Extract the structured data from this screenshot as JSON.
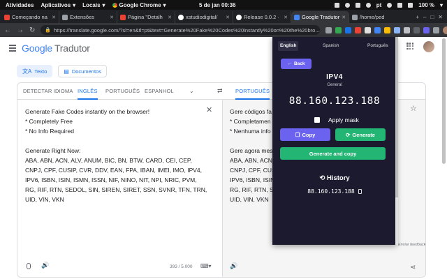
{
  "os_bar": {
    "activities": "Atividades",
    "applications": "Aplicativos",
    "places": "Locais",
    "active_app": "Google Chrome",
    "datetime": "5 de jan  00:36",
    "language": "pt",
    "battery": "100 %"
  },
  "tabs": [
    {
      "label": "Começando na",
      "color": "#ea4335"
    },
    {
      "label": "Extensões",
      "color": "#5f6368"
    },
    {
      "label": "Página \"Detalh",
      "color": "#ea4335"
    },
    {
      "label": "xstudiodigital/",
      "color": "#ffffff"
    },
    {
      "label": "Release 0.0.2 ·",
      "color": "#ffffff"
    },
    {
      "label": "Google Tradutor",
      "color": "#4285f4"
    },
    {
      "label": "/home/ped",
      "color": "#5f6368"
    }
  ],
  "address_bar": {
    "url": "https://translate.google.com/?sl=en&tl=pt&text=Generate%20Fake%20Codes%20instantly%20on%20the%20bro..."
  },
  "translate": {
    "logo_google": "Google",
    "logo_product": "Tradutor",
    "mode_text": "Texto",
    "mode_documents": "Documentos",
    "src_langs": [
      "DETECTAR IDIOMA",
      "INGLÊS",
      "PORTUGUÊS",
      "ESPANHOL"
    ],
    "tgt_langs": [
      "PORTUGUÊS"
    ],
    "source_text": "Generate Fake Codes instantly on the browser!\n* Completely Free\n* No Info Required\n\nGenerate Right Now:\nABA, ABN, ACN, ALV, ANUM, BIC, BN, BTW, CARD, CEI, CEP, CNPJ, CPF, CUSIP, CVR, DDV, EAN, FPA, IBAN, IMEI, IMO, IPV4, IPV6, ISBN, ISIN, ISMN, ISSN, NIF, NINO, NIT, NPI, NRIC, PVM, RG, RIF, RTN, SEDOL, SIN, SIREN, SIRET, SSN, SVNR, TFN, TRN, UID, VIN, VKN",
    "target_text": "Gere códigos fa\n* Completamen\n* Nenhuma info\n\nGere agora mes\nABA, ABN, ACN\nCNPJ, CPF, CUSI\nIPV6, ISBN, ISIN\nRG, RIF, RTN, SE\nUID, VIN, VKN",
    "char_count": "393 / 5.000",
    "feedback": "Enviar feedback"
  },
  "popup": {
    "languages": [
      "English",
      "Spanish",
      "Português"
    ],
    "back_label": "Back",
    "title": "IPV4",
    "subtitle": "General",
    "value": "88.160.123.188",
    "mask_label": "Apply mask",
    "copy_label": "Copy",
    "generate_label": "Generate",
    "generate_copy_label": "Generate and copy",
    "history_title": "History",
    "history": [
      "88.160.123.188"
    ]
  }
}
